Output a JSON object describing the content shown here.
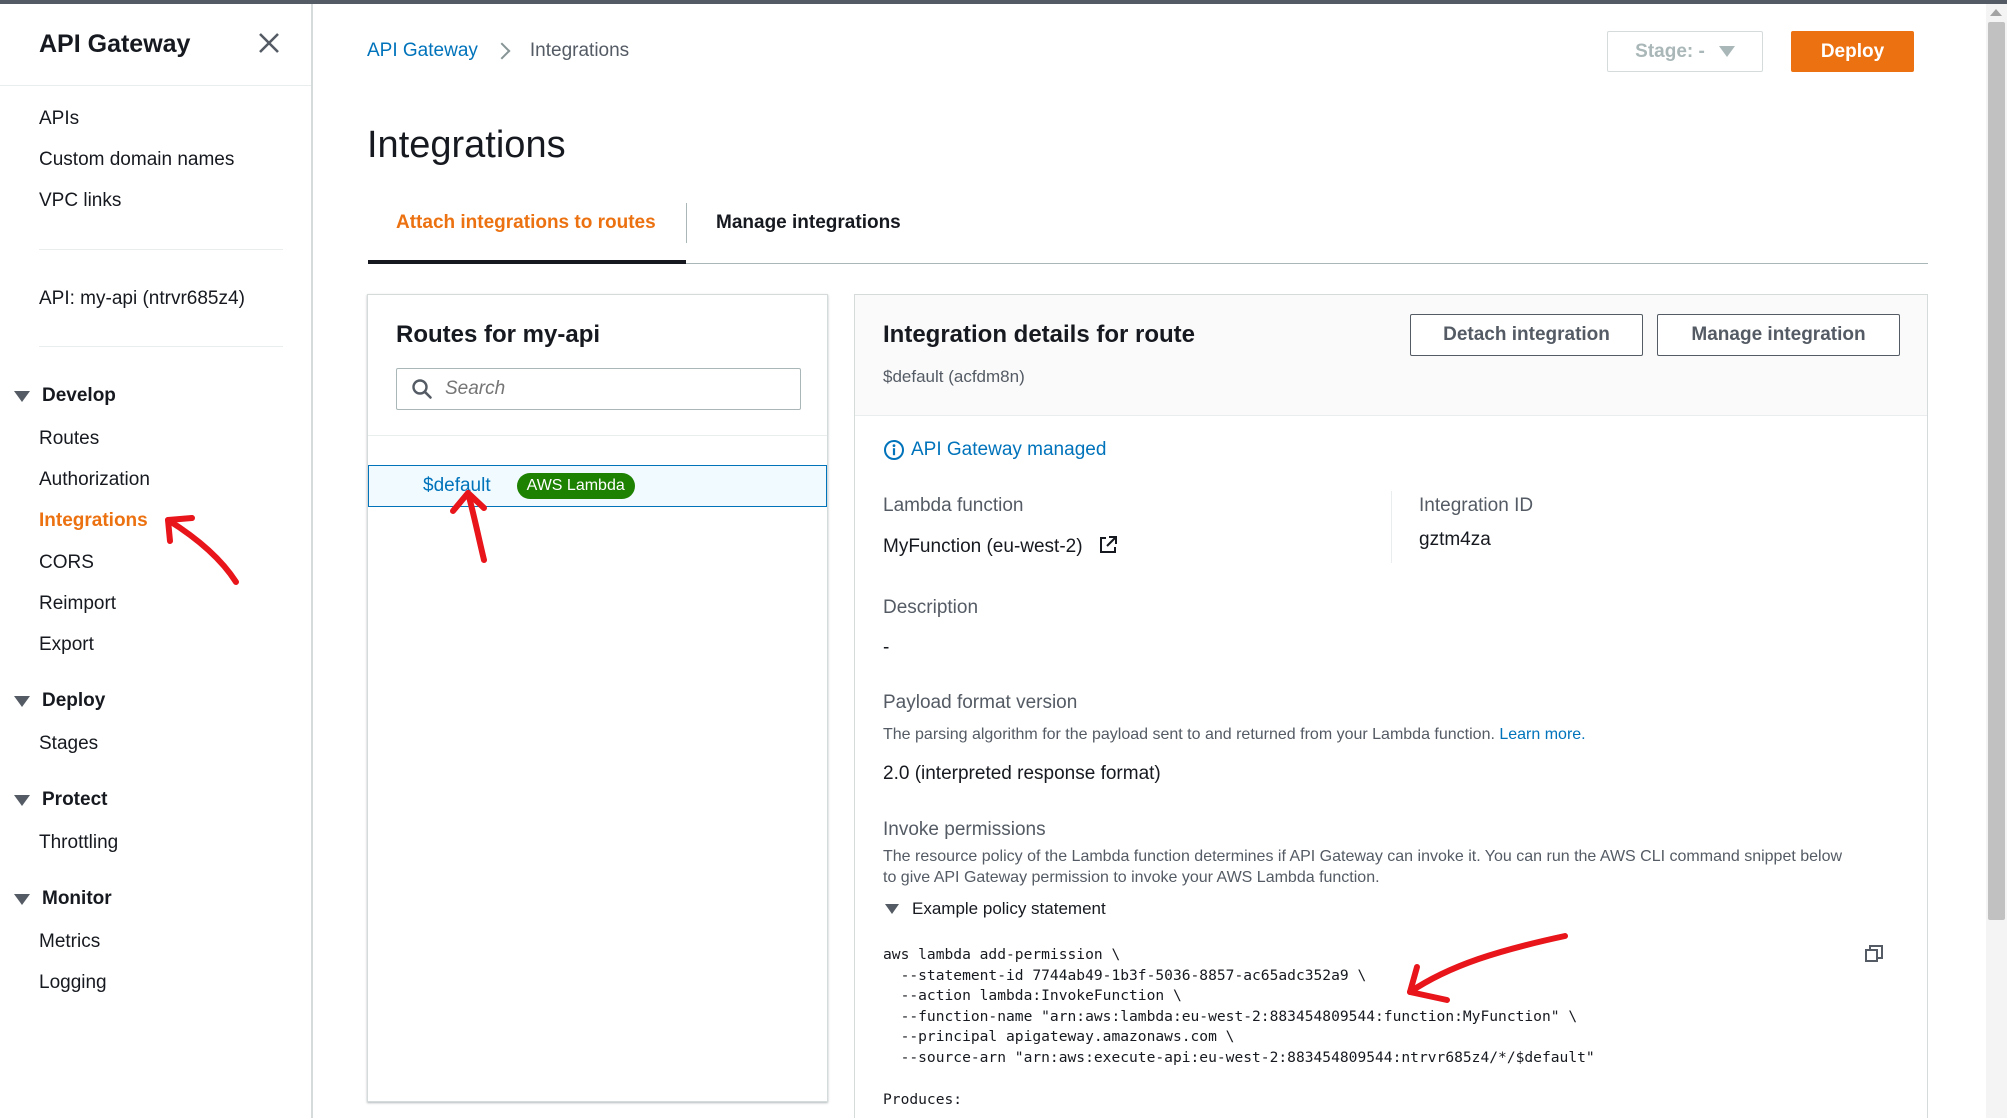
{
  "sidebar": {
    "title": "API Gateway",
    "top_links": [
      "APIs",
      "Custom domain names",
      "VPC links"
    ],
    "api_label": "API: my-api (ntrvr685z4)",
    "sections": [
      {
        "label": "Develop",
        "items": [
          "Routes",
          "Authorization",
          "Integrations",
          "CORS",
          "Reimport",
          "Export"
        ]
      },
      {
        "label": "Deploy",
        "items": [
          "Stages"
        ]
      },
      {
        "label": "Protect",
        "items": [
          "Throttling"
        ]
      },
      {
        "label": "Monitor",
        "items": [
          "Metrics",
          "Logging"
        ]
      }
    ],
    "active_item": "Integrations"
  },
  "breadcrumb": {
    "root": "API Gateway",
    "current": "Integrations"
  },
  "header": {
    "stage_label": "Stage: -",
    "deploy_label": "Deploy",
    "page_title": "Integrations"
  },
  "tabs": [
    {
      "label": "Attach integrations to routes",
      "active": true
    },
    {
      "label": "Manage integrations",
      "active": false
    }
  ],
  "routes": {
    "title": "Routes for my-api",
    "search_placeholder": "Search",
    "items": [
      {
        "path": "$default",
        "badge": "AWS Lambda"
      }
    ]
  },
  "details": {
    "title": "Integration details for route",
    "subtitle": "$default (acfdm8n)",
    "detach_label": "Detach integration",
    "manage_label": "Manage integration",
    "managed_label": "API Gateway managed",
    "lambda_label": "Lambda function",
    "lambda_value": "MyFunction (eu-west-2)",
    "integration_id_label": "Integration ID",
    "integration_id_value": "gztm4za",
    "description_label": "Description",
    "description_value": "-",
    "payload_label": "Payload format version",
    "payload_help": "The parsing algorithm for the payload sent to and returned from your Lambda function.",
    "payload_help_link": "Learn more.",
    "payload_value": "2.0 (interpreted response format)",
    "invoke_label": "Invoke permissions",
    "invoke_help_1": "The resource policy of the Lambda function determines if API Gateway can invoke it. You can run the AWS CLI command snippet below",
    "invoke_help_2": "to give API Gateway permission to invoke your AWS Lambda function.",
    "example_label": "Example policy statement",
    "code_lines": [
      "aws lambda add-permission \\",
      "  --statement-id 7744ab49-1b3f-5036-8857-ac65adc352a9 \\",
      "  --action lambda:InvokeFunction \\",
      "  --function-name \"arn:aws:lambda:eu-west-2:883454809544:function:MyFunction\" \\",
      "  --principal apigateway.amazonaws.com \\",
      "  --source-arn \"arn:aws:execute-api:eu-west-2:883454809544:ntrvr685z4/*/$default\""
    ],
    "produces_label": "Produces:"
  },
  "colors": {
    "accent": "#ec7211",
    "link": "#0073bb",
    "badge": "#1d8102",
    "annotation": "#e8151b"
  }
}
